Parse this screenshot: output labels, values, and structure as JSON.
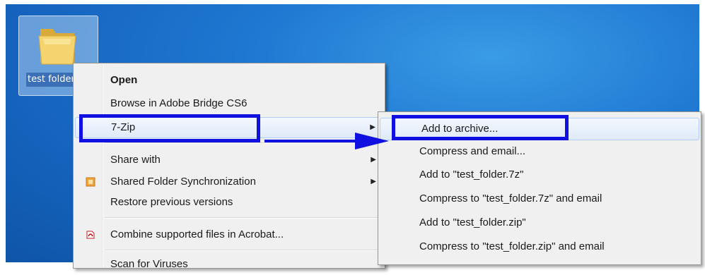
{
  "desktop": {
    "folder": {
      "icon": "folder-icon",
      "label": "test folder"
    }
  },
  "context_menu": {
    "items": [
      {
        "label": "Open",
        "bold": true
      },
      {
        "label": "Browse in Adobe Bridge CS6"
      },
      {
        "label": "7-Zip",
        "submenu": true
      },
      {
        "label": "Share with",
        "submenu": true
      },
      {
        "label": "Shared Folder Synchronization",
        "submenu": true,
        "icon": "sync-icon"
      },
      {
        "label": "Restore previous versions"
      },
      {
        "label": "Combine supported files in Acrobat...",
        "icon": "acrobat-icon"
      },
      {
        "label": "Scan for Viruses"
      }
    ]
  },
  "submenu_7zip": {
    "items": [
      {
        "label": "Add to archive..."
      },
      {
        "label": "Compress and email..."
      },
      {
        "label": "Add to \"test_folder.7z\""
      },
      {
        "label": "Compress to \"test_folder.7z\" and email"
      },
      {
        "label": "Add to \"test_folder.zip\""
      },
      {
        "label": "Compress to \"test_folder.zip\" and email"
      }
    ]
  },
  "annotation": {
    "highlight_color": "#1010e0"
  }
}
